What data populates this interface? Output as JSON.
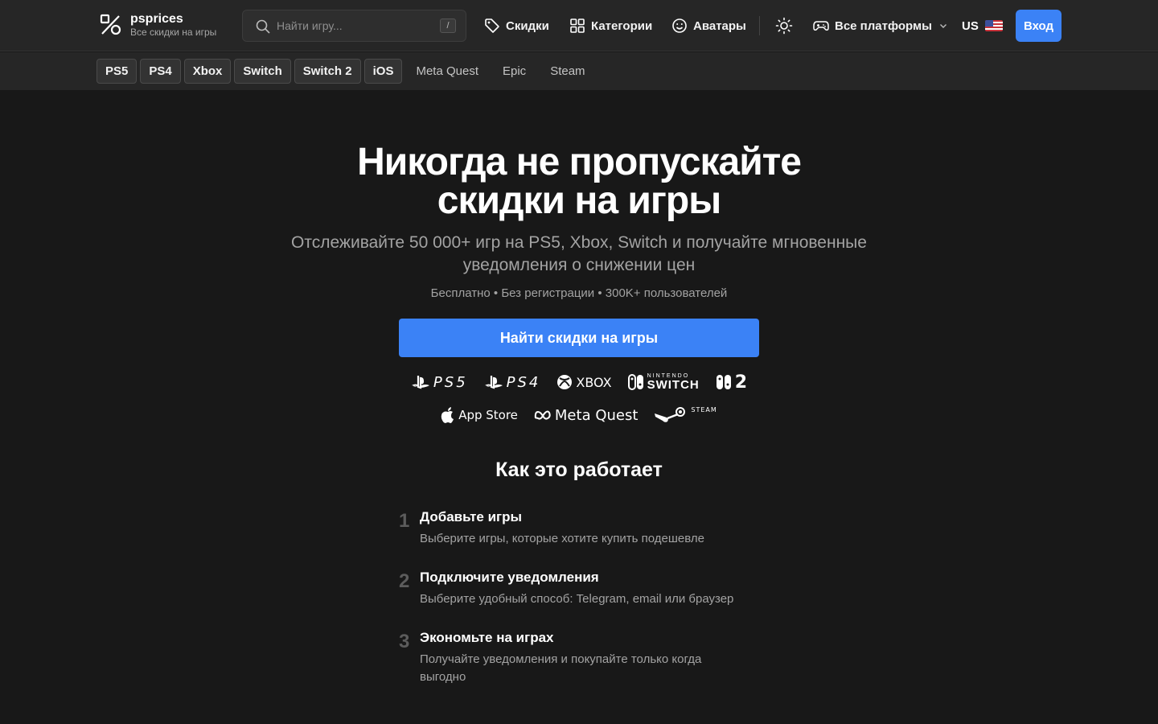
{
  "header": {
    "brand_name": "psprices",
    "brand_tagline": "Все скидки на игры",
    "search": {
      "placeholder": "Найти игру...",
      "shortcut": "/"
    },
    "nav": {
      "deals": "Скидки",
      "categories": "Категории",
      "avatars": "Аватары"
    },
    "platform_select": "Все платформы",
    "region": "US",
    "login": "Вход",
    "accent_color": "#3b82f6"
  },
  "subnav": {
    "chips": [
      "PS5",
      "PS4",
      "Xbox",
      "Switch",
      "Switch 2",
      "iOS"
    ],
    "links": [
      "Meta Quest",
      "Epic",
      "Steam"
    ]
  },
  "hero": {
    "title_line1": "Никогда не пропускайте",
    "title_line2": "скидки на игры",
    "subtitle_line1": "Отслеживайте 50 000+ игр на PS5, Xbox, Switch и получайте мгновенные",
    "subtitle_line2": "уведомления о снижении цен",
    "meta": "Бесплатно • Без регистрации • 300K+ пользователей",
    "cta": "Найти скидки на игры"
  },
  "platform_logos": {
    "ps5": "PS5",
    "ps4": "PS4",
    "xbox": "XBOX",
    "switch_small": "NINTENDO",
    "switch_big": "SWITCH",
    "switch2": "2",
    "appstore": "App Store",
    "metaquest": "Meta Quest",
    "steam": "STEAM"
  },
  "how": {
    "title": "Как это работает",
    "steps": [
      {
        "num": "1",
        "title": "Добавьте игры",
        "desc": "Выберите игры, которые хотите купить подешевле"
      },
      {
        "num": "2",
        "title": "Подключите уведомления",
        "desc": "Выберите удобный способ: Telegram, email или браузер"
      },
      {
        "num": "3",
        "title": "Экономьте на играх",
        "desc": "Получайте уведомления и покупайте только когда выгодно"
      }
    ]
  }
}
